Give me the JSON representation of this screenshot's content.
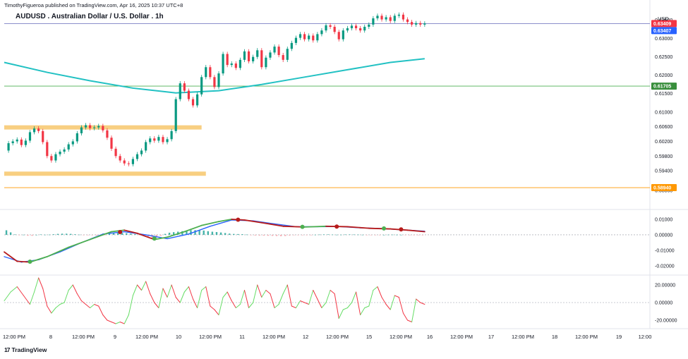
{
  "header": {
    "published_by": "TimothyFigueroa published on TradingView.com, Apr 16, 2025 10:37 UTC+8",
    "symbol_title": "AUDUSD . Australian Dollar / U.S. Dollar . 1h",
    "currency": "USD"
  },
  "footer": {
    "logo_glyph": "17",
    "brand": "TradingView"
  },
  "colors": {
    "up": "#089981",
    "down": "#f23645",
    "ma": "#22c1c3",
    "sr_zone": "#f7c76b",
    "level_green": "#4caf50",
    "level_orange": "#ff9800",
    "level_blue": "#7b7fc4",
    "macd_fast": "#4caf50",
    "macd_slow": "#2962ff",
    "macd_down": "#b71c1c",
    "osc_up": "#66dd66",
    "osc_down": "#f23645"
  },
  "chart_data": [
    {
      "type": "candlestick",
      "title": "AUDUSD . Australian Dollar / U.S. Dollar . 1h",
      "ylim": [
        0.5848,
        0.6355
      ],
      "y_ticks": [
        "0.63500",
        "0.63000",
        "0.62500",
        "0.62000",
        "0.61500",
        "0.61000",
        "0.60600",
        "0.60200",
        "0.59800",
        "0.59400",
        "0.58860"
      ],
      "y_tick_values": [
        0.635,
        0.63,
        0.625,
        0.62,
        0.615,
        0.61,
        0.606,
        0.602,
        0.598,
        0.594,
        0.5886
      ],
      "x_ticks": [
        "12:00 PM",
        "8",
        "12:00 PM",
        "9",
        "12:00 PM",
        "10",
        "12:00 PM",
        "11",
        "12:00 PM",
        "12",
        "12:00 PM",
        "15",
        "12:00 PM",
        "16",
        "12:00 PM",
        "17",
        "12:00 PM",
        "18",
        "12:00 PM",
        "19",
        "12:00"
      ],
      "price_tags": [
        {
          "label": "0.63409",
          "value": 0.63409,
          "color": "#f23645"
        },
        {
          "label": "0.63407",
          "value": 0.63407,
          "color": "#2962ff"
        },
        {
          "label": "0.61705",
          "value": 0.61705,
          "color": "#388e3c"
        },
        {
          "label": "0.58940",
          "value": 0.5894,
          "color": "#ff9800"
        }
      ],
      "horizontal_levels": [
        {
          "value": 0.63407,
          "color": "#7b7fc4"
        },
        {
          "value": 0.61705,
          "color": "#4caf50"
        },
        {
          "value": 0.5894,
          "color": "#ff9800"
        }
      ],
      "zones": [
        {
          "from_x": 0,
          "to_x": 92,
          "value": 0.6058
        },
        {
          "from_x": 0,
          "to_x": 94,
          "value": 0.5932
        }
      ],
      "close_path": [
        [
          0,
          0.5995
        ],
        [
          2,
          0.6015
        ],
        [
          4,
          0.602
        ],
        [
          6,
          0.6025
        ],
        [
          8,
          0.601
        ],
        [
          10,
          0.6022
        ],
        [
          12,
          0.6045
        ],
        [
          14,
          0.6055
        ],
        [
          16,
          0.6048
        ],
        [
          18,
          0.6018
        ],
        [
          20,
          0.598
        ],
        [
          22,
          0.5968
        ],
        [
          24,
          0.5985
        ],
        [
          26,
          0.5992
        ],
        [
          28,
          0.5998
        ],
        [
          30,
          0.6012
        ],
        [
          32,
          0.602
        ],
        [
          34,
          0.6042
        ],
        [
          36,
          0.6058
        ],
        [
          38,
          0.6064
        ],
        [
          40,
          0.6056
        ],
        [
          42,
          0.6058
        ],
        [
          44,
          0.6062
        ],
        [
          46,
          0.605
        ],
        [
          48,
          0.603
        ],
        [
          50,
          0.6
        ],
        [
          52,
          0.598
        ],
        [
          54,
          0.5968
        ],
        [
          56,
          0.596
        ],
        [
          58,
          0.5958
        ],
        [
          60,
          0.5972
        ],
        [
          62,
          0.5985
        ],
        [
          64,
          0.5995
        ],
        [
          66,
          0.6018
        ],
        [
          68,
          0.6028
        ],
        [
          70,
          0.6022
        ],
        [
          72,
          0.6032
        ],
        [
          74,
          0.6018
        ],
        [
          76,
          0.6026
        ],
        [
          78,
          0.6048
        ],
        [
          80,
          0.6135
        ],
        [
          82,
          0.6178
        ],
        [
          84,
          0.6158
        ],
        [
          86,
          0.6135
        ],
        [
          88,
          0.6118
        ],
        [
          90,
          0.6148
        ],
        [
          92,
          0.6195
        ],
        [
          94,
          0.6222
        ],
        [
          96,
          0.6195
        ],
        [
          98,
          0.6168
        ],
        [
          100,
          0.6205
        ],
        [
          102,
          0.6258
        ],
        [
          104,
          0.6228
        ],
        [
          106,
          0.6232
        ],
        [
          108,
          0.622
        ],
        [
          110,
          0.6242
        ],
        [
          112,
          0.6265
        ],
        [
          114,
          0.6238
        ],
        [
          116,
          0.625
        ],
        [
          118,
          0.6268
        ],
        [
          120,
          0.6222
        ],
        [
          122,
          0.6248
        ],
        [
          124,
          0.6262
        ],
        [
          126,
          0.6278
        ],
        [
          128,
          0.6255
        ],
        [
          130,
          0.6242
        ],
        [
          132,
          0.6272
        ],
        [
          134,
          0.6288
        ],
        [
          136,
          0.6302
        ],
        [
          138,
          0.6312
        ],
        [
          140,
          0.6298
        ],
        [
          142,
          0.6308
        ],
        [
          144,
          0.6295
        ],
        [
          146,
          0.6312
        ],
        [
          148,
          0.6322
        ],
        [
          150,
          0.6336
        ],
        [
          152,
          0.6332
        ],
        [
          154,
          0.6318
        ],
        [
          156,
          0.6298
        ],
        [
          158,
          0.6322
        ],
        [
          160,
          0.6328
        ],
        [
          162,
          0.6335
        ],
        [
          164,
          0.6328
        ],
        [
          166,
          0.6322
        ],
        [
          168,
          0.6332
        ],
        [
          170,
          0.6338
        ],
        [
          172,
          0.6355
        ],
        [
          174,
          0.6362
        ],
        [
          176,
          0.6352
        ],
        [
          178,
          0.6358
        ],
        [
          180,
          0.6348
        ],
        [
          182,
          0.6362
        ],
        [
          184,
          0.6365
        ],
        [
          186,
          0.6352
        ],
        [
          188,
          0.6345
        ],
        [
          190,
          0.6338
        ],
        [
          192,
          0.6342
        ],
        [
          194,
          0.6338
        ],
        [
          196,
          0.6341
        ]
      ],
      "series": [
        {
          "name": "",
          "kind": "moving-average",
          "values": [
            [
              0,
              0.6235
            ],
            [
              20,
              0.6208
            ],
            [
              40,
              0.6185
            ],
            [
              60,
              0.6165
            ],
            [
              80,
              0.6152
            ],
            [
              100,
              0.6158
            ],
            [
              120,
              0.6175
            ],
            [
              140,
              0.6195
            ],
            [
              160,
              0.6215
            ],
            [
              180,
              0.6235
            ],
            [
              196,
              0.6245
            ]
          ]
        }
      ],
      "x_range": [
        0,
        300
      ]
    },
    {
      "type": "line",
      "title": "",
      "ylim": [
        -0.024,
        0.014
      ],
      "y_ticks": [
        "0.01000",
        "0.00000",
        "-0.01000",
        "-0.02000"
      ],
      "y_tick_values": [
        0.01,
        0.0,
        -0.01,
        -0.02
      ],
      "x_range": [
        0,
        300
      ],
      "series": [
        {
          "name": "",
          "values": [
            [
              0,
              -0.011
            ],
            [
              6,
              -0.017
            ],
            [
              12,
              -0.0175
            ],
            [
              20,
              -0.014
            ],
            [
              30,
              -0.008
            ],
            [
              40,
              -0.003
            ],
            [
              50,
              0.002
            ],
            [
              56,
              0.003
            ],
            [
              62,
              0.001
            ],
            [
              70,
              -0.003
            ],
            [
              76,
              -0.0015
            ],
            [
              84,
              0.002
            ],
            [
              92,
              0.006
            ],
            [
              100,
              0.0085
            ],
            [
              106,
              0.01
            ],
            [
              112,
              0.0095
            ],
            [
              120,
              0.0078
            ],
            [
              130,
              0.0055
            ],
            [
              140,
              0.005
            ],
            [
              150,
              0.0055
            ],
            [
              160,
              0.0052
            ],
            [
              170,
              0.0042
            ],
            [
              180,
              0.0038
            ],
            [
              188,
              0.003
            ],
            [
              196,
              0.002
            ]
          ]
        },
        {
          "name": "",
          "values": [
            [
              0,
              -0.014
            ],
            [
              8,
              -0.0175
            ],
            [
              16,
              -0.016
            ],
            [
              26,
              -0.011
            ],
            [
              36,
              -0.005
            ],
            [
              46,
              0.0005
            ],
            [
              56,
              0.002
            ],
            [
              66,
              0.0
            ],
            [
              76,
              -0.0025
            ],
            [
              86,
              0.0005
            ],
            [
              96,
              0.0055
            ],
            [
              106,
              0.0095
            ],
            [
              116,
              0.009
            ],
            [
              126,
              0.007
            ],
            [
              136,
              0.0052
            ],
            [
              146,
              0.0052
            ],
            [
              156,
              0.0053
            ],
            [
              166,
              0.0045
            ],
            [
              176,
              0.004
            ],
            [
              186,
              0.0032
            ],
            [
              196,
              0.0023
            ]
          ]
        }
      ],
      "markers": [
        {
          "x": 12,
          "y": -0.0172,
          "color": "#4caf50"
        },
        {
          "x": 54,
          "y": 0.0018,
          "color": "#b71c1c"
        },
        {
          "x": 70,
          "y": -0.0024,
          "color": "#4caf50"
        },
        {
          "x": 109,
          "y": 0.0097,
          "color": "#b71c1c"
        },
        {
          "x": 139,
          "y": 0.0051,
          "color": "#4caf50"
        },
        {
          "x": 155,
          "y": 0.0053,
          "color": "#b71c1c"
        },
        {
          "x": 177,
          "y": 0.0041,
          "color": "#4caf50"
        },
        {
          "x": 185,
          "y": 0.0035,
          "color": "#b71c1c"
        }
      ]
    },
    {
      "type": "line",
      "title": "",
      "ylim": [
        -28,
        28
      ],
      "y_ticks": [
        "20.00000",
        "0.00000",
        "-20.00000"
      ],
      "y_tick_values": [
        20,
        0,
        -20
      ],
      "x_range": [
        0,
        300
      ],
      "series": [
        {
          "name": "",
          "values": [
            [
              0,
              2
            ],
            [
              3,
              12
            ],
            [
              6,
              18
            ],
            [
              9,
              8
            ],
            [
              12,
              -2
            ],
            [
              14,
              12
            ],
            [
              16,
              28
            ],
            [
              18,
              16
            ],
            [
              20,
              -4
            ],
            [
              22,
              -12
            ],
            [
              24,
              -6
            ],
            [
              26,
              -2
            ],
            [
              28,
              0
            ],
            [
              30,
              14
            ],
            [
              32,
              20
            ],
            [
              34,
              10
            ],
            [
              36,
              2
            ],
            [
              38,
              -2
            ],
            [
              40,
              -6
            ],
            [
              42,
              -2
            ],
            [
              44,
              -4
            ],
            [
              46,
              -14
            ],
            [
              48,
              -20
            ],
            [
              50,
              -22
            ],
            [
              52,
              -24
            ],
            [
              54,
              -22
            ],
            [
              56,
              -24
            ],
            [
              58,
              -14
            ],
            [
              60,
              8
            ],
            [
              62,
              20
            ],
            [
              64,
              14
            ],
            [
              66,
              24
            ],
            [
              68,
              10
            ],
            [
              70,
              0
            ],
            [
              72,
              -6
            ],
            [
              74,
              16
            ],
            [
              76,
              6
            ],
            [
              78,
              20
            ],
            [
              80,
              6
            ],
            [
              82,
              0
            ],
            [
              84,
              12
            ],
            [
              86,
              18
            ],
            [
              88,
              4
            ],
            [
              90,
              -6
            ],
            [
              92,
              14
            ],
            [
              94,
              18
            ],
            [
              96,
              -4
            ],
            [
              98,
              -8
            ],
            [
              100,
              -14
            ],
            [
              102,
              6
            ],
            [
              104,
              12
            ],
            [
              106,
              2
            ],
            [
              108,
              -6
            ],
            [
              110,
              -2
            ],
            [
              112,
              14
            ],
            [
              114,
              -6
            ],
            [
              116,
              0
            ],
            [
              118,
              20
            ],
            [
              120,
              6
            ],
            [
              122,
              14
            ],
            [
              124,
              10
            ],
            [
              126,
              -6
            ],
            [
              128,
              -2
            ],
            [
              130,
              10
            ],
            [
              132,
              20
            ],
            [
              134,
              -4
            ],
            [
              136,
              -6
            ],
            [
              138,
              2
            ],
            [
              140,
              0
            ],
            [
              142,
              -2
            ],
            [
              144,
              14
            ],
            [
              146,
              4
            ],
            [
              148,
              -6
            ],
            [
              150,
              0
            ],
            [
              152,
              14
            ],
            [
              154,
              10
            ],
            [
              156,
              -18
            ],
            [
              158,
              -8
            ],
            [
              160,
              -6
            ],
            [
              162,
              0
            ],
            [
              164,
              12
            ],
            [
              166,
              -14
            ],
            [
              168,
              -6
            ],
            [
              170,
              -4
            ],
            [
              172,
              14
            ],
            [
              174,
              18
            ],
            [
              176,
              6
            ],
            [
              178,
              -2
            ],
            [
              180,
              -8
            ],
            [
              182,
              8
            ],
            [
              184,
              6
            ],
            [
              186,
              -12
            ],
            [
              188,
              -20
            ],
            [
              190,
              -22
            ],
            [
              192,
              4
            ],
            [
              194,
              0
            ],
            [
              196,
              -2
            ]
          ]
        }
      ]
    }
  ]
}
